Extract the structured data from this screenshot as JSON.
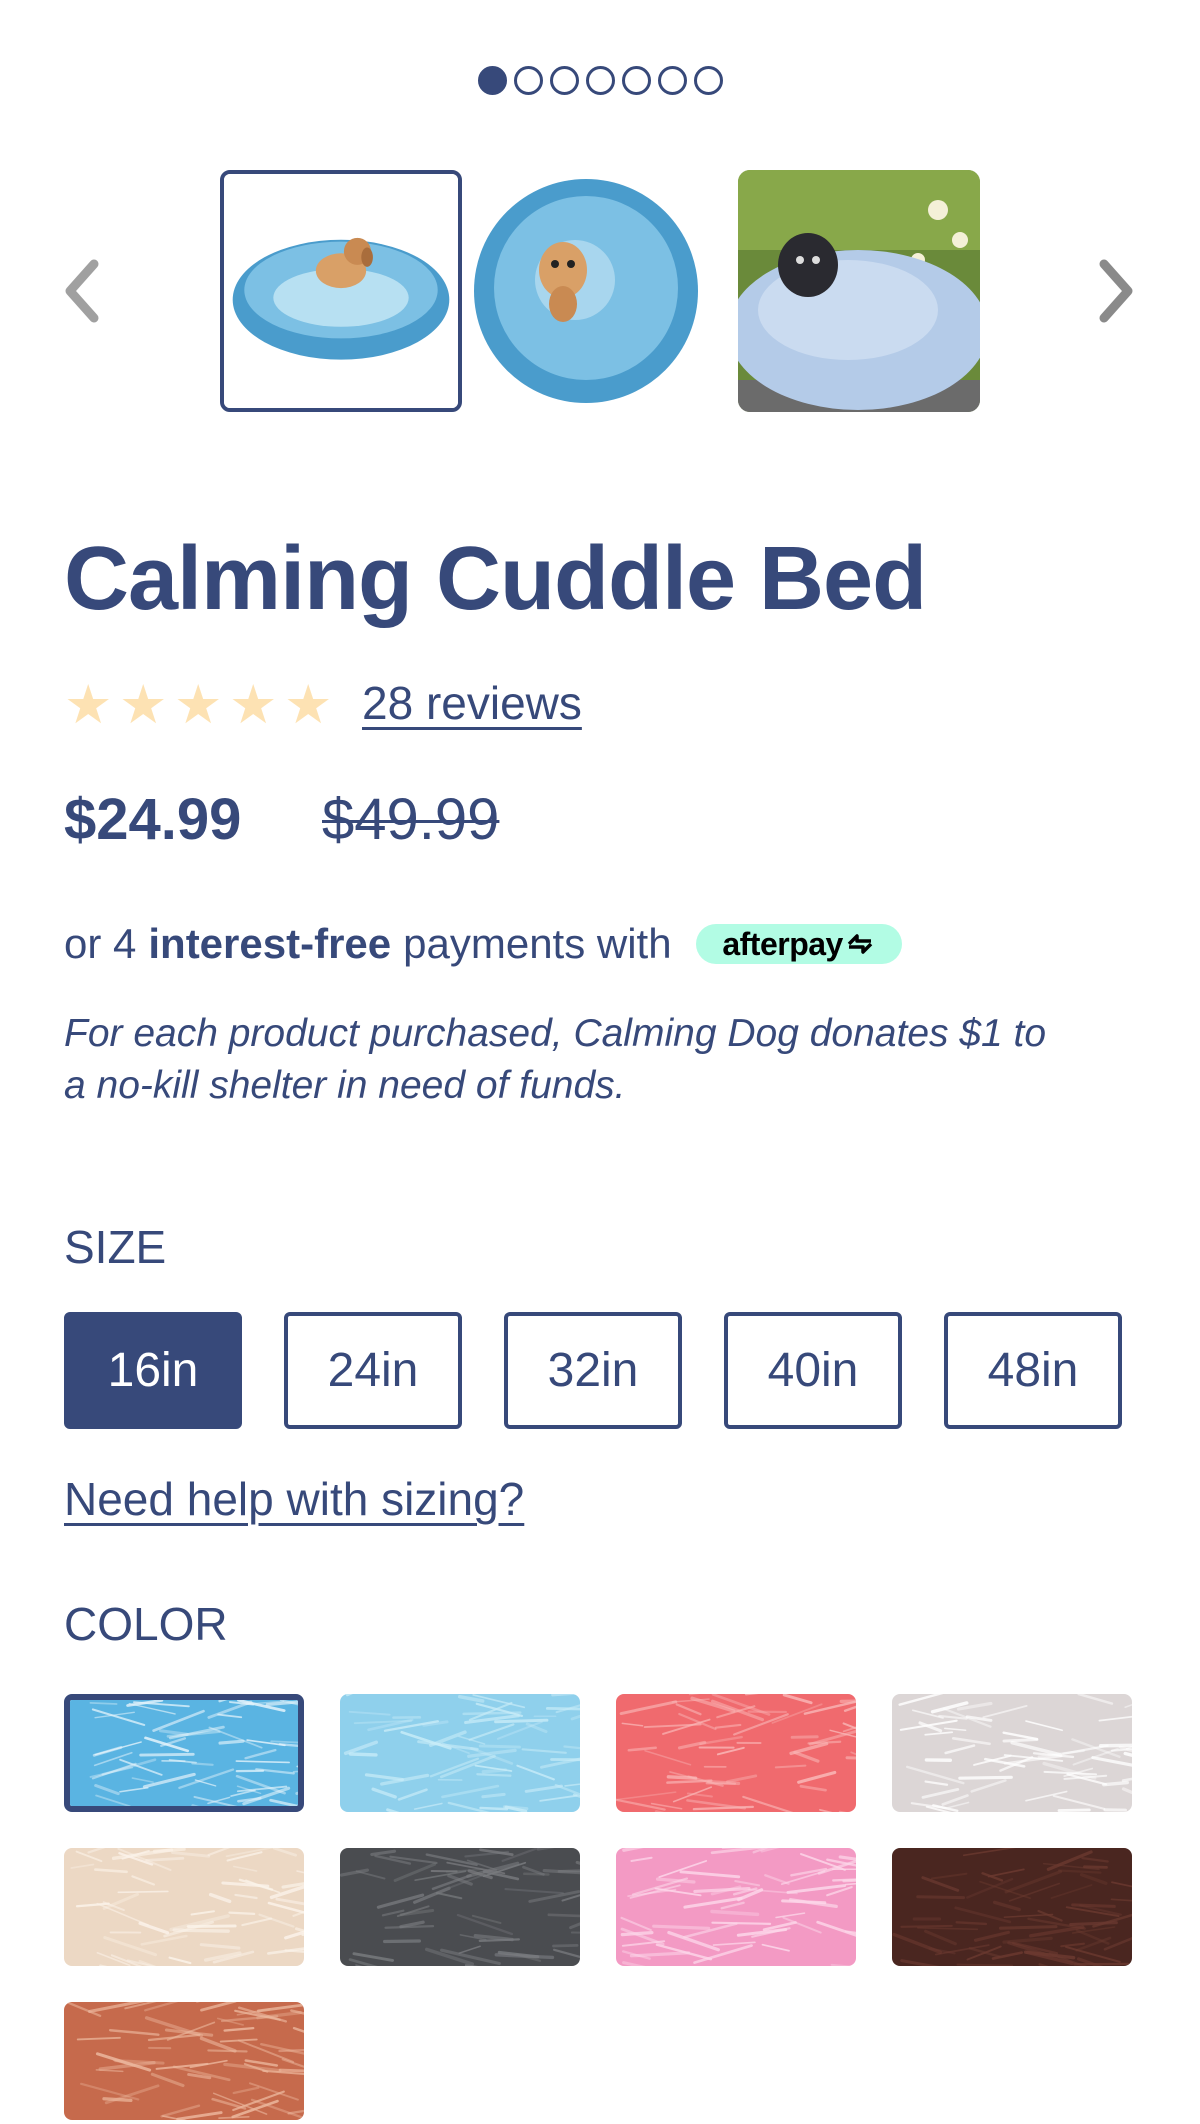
{
  "carousel": {
    "dot_count": 7,
    "active_dot": 0,
    "prev_icon": "chevron-left-icon",
    "next_icon": "chevron-right-icon",
    "thumbnails": [
      {
        "name": "blue-bed-puppy-side",
        "selected": true
      },
      {
        "name": "blue-bed-puppy-front",
        "selected": false
      },
      {
        "name": "light-blue-bed-outdoor-dog",
        "selected": false
      }
    ]
  },
  "product": {
    "title": "Calming Cuddle Bed",
    "rating_stars": 5,
    "reviews_label": "28 reviews",
    "price": "$24.99",
    "old_price": "$49.99"
  },
  "afterpay": {
    "prefix": "or 4",
    "bold": "interest-free",
    "suffix": "payments with",
    "badge": "afterpay"
  },
  "donation_text": "For each product purchased, Calming Dog donates $1 to a no-kill shelter in need of funds.",
  "size": {
    "label": "SIZE",
    "options": [
      "16in",
      "24in",
      "32in",
      "40in",
      "48in"
    ],
    "selected": "16in",
    "help_link": "Need help with sizing?"
  },
  "color": {
    "label": "COLOR",
    "swatches": [
      {
        "name": "blue-tie-dye",
        "color": "#5ab4e2",
        "accent": "#e6f4fb",
        "selected": true
      },
      {
        "name": "sky-blue",
        "color": "#8fd0ec",
        "accent": "#c9ecf8",
        "selected": false
      },
      {
        "name": "coral-red",
        "color": "#f06a6e",
        "accent": "#f9b7b7",
        "selected": false
      },
      {
        "name": "light-gray",
        "color": "#dcd6d6",
        "accent": "#ffffff",
        "selected": false
      },
      {
        "name": "cream",
        "color": "#ecd8c4",
        "accent": "#fbf3ea",
        "selected": false
      },
      {
        "name": "charcoal",
        "color": "#4a4c50",
        "accent": "#7a7c80",
        "selected": false
      },
      {
        "name": "pink",
        "color": "#f39ac4",
        "accent": "#fcd8ea",
        "selected": false
      },
      {
        "name": "chocolate",
        "color": "#4a2620",
        "accent": "#6c3a30",
        "selected": false
      },
      {
        "name": "rust",
        "color": "#c66a4c",
        "accent": "#ecb89e",
        "selected": false
      }
    ]
  },
  "colors": {
    "brand": "#37497a",
    "star": "#fde2b3",
    "afterpay": "#b2fce4"
  }
}
